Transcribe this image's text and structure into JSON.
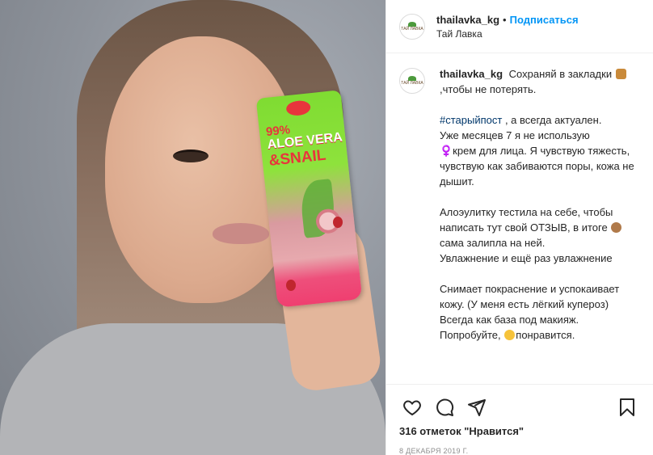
{
  "photo": {
    "alt": "",
    "product": {
      "percent": "99%",
      "line1": "ALOE VERA",
      "line2": "&SNAIL"
    }
  },
  "header": {
    "username": "thailavka_kg",
    "separator": "•",
    "follow_label": "Подписаться",
    "location": "Тай Лавка",
    "avatar_text": "ТАЙ ЛАВКА"
  },
  "caption": {
    "username": "thailavka_kg",
    "intro_a": "Сохраняй в закладки",
    "intro_b": ",чтобы не потерять.",
    "hashtag": "#старыйпост",
    "p2_rest": " , а всегда актуален.",
    "p2_b": "Уже месяцев 7 я не использую",
    "p2_c": "‍♀️крем для лица. Я чувствую тяжесть, чувствую как забиваются поры, кожа не дышит.",
    "p3_a": "Алоэулитку тестила на себе, чтобы написать тут свой ОТЗЫВ, в итоге",
    "p3_b": "сама залипла на ней.",
    "p3_c": "Увлажнение ‍‍и ещё раз увлажнение",
    "p4_a": "Снимает покраснение и успокаивает кожу. (У меня есть лёгкий купероз)",
    "p4_b": "Всегда ‍‍как база под макияж.",
    "p4_c": "Попробуйте,",
    "p4_d": "понравится."
  },
  "actions": {
    "like_icon": "heart-icon",
    "comment_icon": "comment-icon",
    "share_icon": "share-icon",
    "save_icon": "bookmark-icon"
  },
  "likes": "316 отметок \"Нравится\"",
  "date": "8 ДЕКАБРЯ 2019 Г."
}
